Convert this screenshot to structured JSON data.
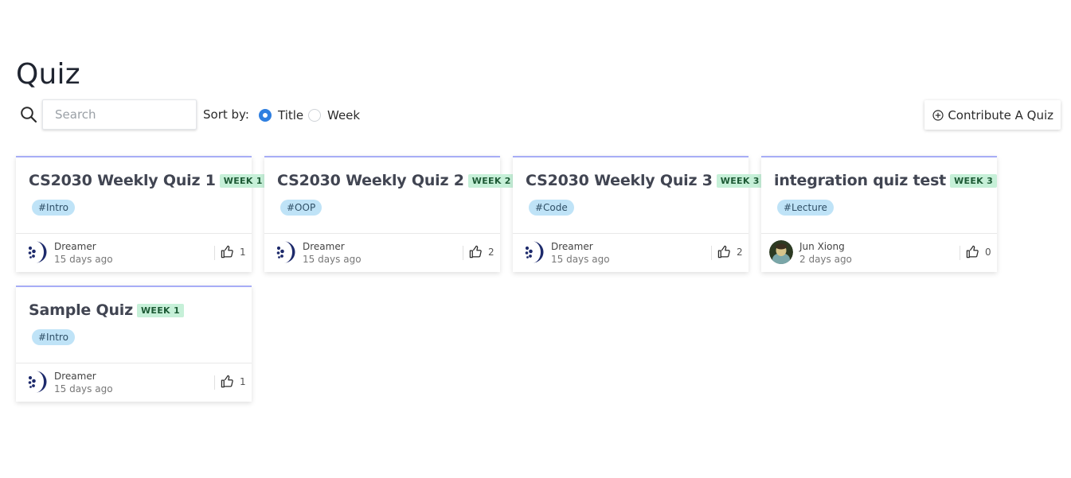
{
  "page": {
    "title": "Quiz"
  },
  "toolbar": {
    "search_icon": "search-icon",
    "search_placeholder": "Search",
    "search_value": "",
    "sort_label": "Sort by:",
    "sort_options": [
      {
        "label": "Title",
        "checked": true
      },
      {
        "label": "Week",
        "checked": false
      }
    ],
    "contribute_icon": "plus-circle-icon",
    "contribute_label": "Contribute A Quiz"
  },
  "colors": {
    "accent": "#2f7fe0",
    "card_top_border": "#a7adf6",
    "week_badge_bg": "#c6f0d8",
    "tag_bg": "#bfe3f7"
  },
  "cards": [
    {
      "title": "CS2030 Weekly Quiz 1",
      "week": "WEEK 1",
      "tag": "#Intro",
      "author": "Dreamer",
      "time": "15 days ago",
      "likes": "1",
      "avatar": "dreamer-logo"
    },
    {
      "title": "CS2030 Weekly Quiz 2",
      "week": "WEEK 2",
      "tag": "#OOP",
      "author": "Dreamer",
      "time": "15 days ago",
      "likes": "2",
      "avatar": "dreamer-logo"
    },
    {
      "title": "CS2030 Weekly Quiz 3",
      "week": "WEEK 3",
      "tag": "#Code",
      "author": "Dreamer",
      "time": "15 days ago",
      "likes": "2",
      "avatar": "dreamer-logo"
    },
    {
      "title": "integration quiz test",
      "week": "WEEK 3",
      "tag": "#Lecture",
      "author": "Jun Xiong",
      "time": "2 days ago",
      "likes": "0",
      "avatar": "user-photo"
    },
    {
      "title": "Sample Quiz",
      "week": "WEEK 1",
      "tag": "#Intro",
      "author": "Dreamer",
      "time": "15 days ago",
      "likes": "1",
      "avatar": "dreamer-logo"
    }
  ]
}
